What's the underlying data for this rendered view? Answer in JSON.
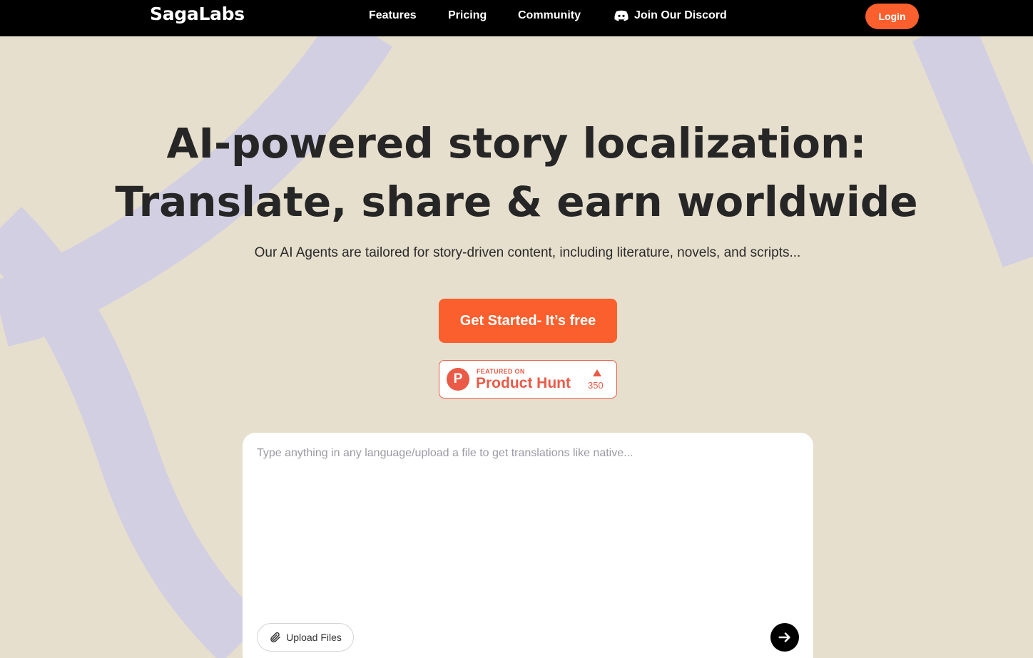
{
  "nav": {
    "logo": "SagaLabs",
    "links": [
      {
        "label": "Features"
      },
      {
        "label": "Pricing"
      },
      {
        "label": "Community"
      },
      {
        "label": "Join Our Discord",
        "icon": "discord-icon"
      }
    ],
    "login_label": "Login"
  },
  "hero": {
    "title_line1": "AI-powered story localization:",
    "title_line2": "Translate, share & earn worldwide",
    "subtitle": "Our AI Agents are tailored for story-driven content, including literature, novels, and scripts...",
    "cta_label": "Get Started- It’s free"
  },
  "product_hunt": {
    "logo_letter": "P",
    "featured_label": "FEATURED ON",
    "name": "Product Hunt",
    "upvotes": "350",
    "upvote_icon": "triangle-up-icon"
  },
  "composer": {
    "placeholder": "Type anything in any language/upload a file to get translations like native...",
    "upload_label": "Upload Files",
    "upload_icon": "paperclip-icon",
    "send_icon": "arrow-right-icon"
  },
  "colors": {
    "accent": "#fb5f2d",
    "background": "#e6dfcd",
    "nav_bg": "#000000",
    "decor": "#d2cfe2",
    "product_hunt": "#ea5a47"
  }
}
